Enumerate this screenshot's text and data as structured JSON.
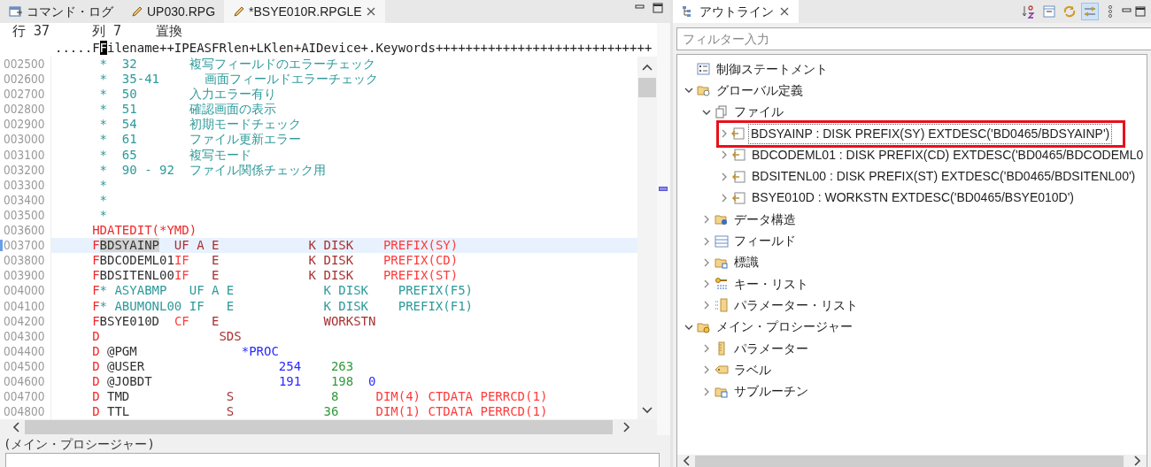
{
  "editor_tabs": [
    {
      "label": "コマンド・ログ",
      "kind": "log",
      "selected": false
    },
    {
      "label": "UP030.RPG",
      "kind": "source",
      "selected": false
    },
    {
      "label": "*BSYE010R.RPGLE",
      "kind": "source",
      "selected": true
    }
  ],
  "editor": {
    "position": {
      "line": "行 37",
      "column": "列 7",
      "mode": "置換"
    },
    "ruler": {
      "before": ".....F",
      "cursor": "F",
      "after": "ilename++IPEASFRlen+LKlen+AIDevice+.Keywords+++++++++++++++++++++++++++++"
    },
    "lines": [
      {
        "number": "002500",
        "current": false,
        "segments": [
          {
            "kind": "comment",
            "text": "      *  32       複写フィールドのエラーチェック"
          }
        ]
      },
      {
        "number": "002600",
        "current": false,
        "segments": [
          {
            "kind": "comment",
            "text": "      *  35-41      画面フィールドエラーチェック"
          }
        ]
      },
      {
        "number": "002700",
        "current": false,
        "segments": [
          {
            "kind": "comment",
            "text": "      *  50       入力エラー有り"
          }
        ]
      },
      {
        "number": "002800",
        "current": false,
        "segments": [
          {
            "kind": "comment",
            "text": "      *  51       確認画面の表示"
          }
        ]
      },
      {
        "number": "002900",
        "current": false,
        "segments": [
          {
            "kind": "comment",
            "text": "      *  54       初期モードチェック"
          }
        ]
      },
      {
        "number": "003000",
        "current": false,
        "segments": [
          {
            "kind": "comment",
            "text": "      *  61       ファイル更新エラー"
          }
        ]
      },
      {
        "number": "003100",
        "current": false,
        "segments": [
          {
            "kind": "comment",
            "text": "      *  65       複写モード"
          }
        ]
      },
      {
        "number": "003200",
        "current": false,
        "segments": [
          {
            "kind": "comment",
            "text": "      *  90 - 92  ファイル関係チェック用"
          }
        ]
      },
      {
        "number": "003300",
        "current": false,
        "segments": [
          {
            "kind": "comment",
            "text": "      *"
          }
        ]
      },
      {
        "number": "003400",
        "current": false,
        "segments": [
          {
            "kind": "comment",
            "text": "      *"
          }
        ]
      },
      {
        "number": "003500",
        "current": false,
        "segments": [
          {
            "kind": "comment",
            "text": "      *"
          }
        ]
      },
      {
        "number": "003600",
        "current": false,
        "segments": [
          {
            "kind": "spec",
            "text": "     HDATEDIT(*YMD)"
          }
        ]
      },
      {
        "number": "003700",
        "current": true,
        "segments": [
          {
            "kind": "spec",
            "text": "     F"
          },
          {
            "kind": "marked",
            "text": "BDSYAINP"
          },
          {
            "kind": "attr",
            "text": "  UF A E            K DISK    "
          },
          {
            "kind": "keyword",
            "text": "PREFIX(SY)"
          }
        ]
      },
      {
        "number": "003800",
        "current": false,
        "segments": [
          {
            "kind": "spec",
            "text": "     F"
          },
          {
            "kind": "name",
            "text": "BDCODEML01"
          },
          {
            "kind": "keyword",
            "text": "IF"
          },
          {
            "kind": "attr",
            "text": "   E            K DISK    "
          },
          {
            "kind": "keyword",
            "text": "PREFIX(CD)"
          }
        ]
      },
      {
        "number": "003900",
        "current": false,
        "segments": [
          {
            "kind": "spec",
            "text": "     F"
          },
          {
            "kind": "name",
            "text": "BDSITENL00"
          },
          {
            "kind": "keyword",
            "text": "IF"
          },
          {
            "kind": "attr",
            "text": "   E            K DISK    "
          },
          {
            "kind": "keyword",
            "text": "PREFIX(ST)"
          }
        ]
      },
      {
        "number": "004000",
        "current": false,
        "segments": [
          {
            "kind": "spec",
            "text": "     F"
          },
          {
            "kind": "comment",
            "text": "* ASYABMP   UF A E            K DISK    PREFIX(F5)"
          }
        ]
      },
      {
        "number": "004100",
        "current": false,
        "segments": [
          {
            "kind": "spec",
            "text": "     F"
          },
          {
            "kind": "comment",
            "text": "* ABUMONL00 IF   E            K DISK    PREFIX(F1)"
          }
        ]
      },
      {
        "number": "004200",
        "current": false,
        "segments": [
          {
            "kind": "spec",
            "text": "     F"
          },
          {
            "kind": "name",
            "text": "BSYE010D  "
          },
          {
            "kind": "keyword",
            "text": "CF"
          },
          {
            "kind": "attr",
            "text": "   E              WORKSTN"
          }
        ]
      },
      {
        "number": "004300",
        "current": false,
        "segments": [
          {
            "kind": "spec",
            "text": "     D"
          },
          {
            "kind": "attr",
            "text": "                SDS"
          }
        ]
      },
      {
        "number": "004400",
        "current": false,
        "segments": [
          {
            "kind": "spec",
            "text": "     D"
          },
          {
            "kind": "name",
            "text": " @PGM"
          },
          {
            "kind": "number",
            "text": "              *PROC"
          }
        ]
      },
      {
        "number": "004500",
        "current": false,
        "segments": [
          {
            "kind": "spec",
            "text": "     D"
          },
          {
            "kind": "name",
            "text": " @USER"
          },
          {
            "kind": "number",
            "text": "                  254"
          },
          {
            "kind": "position",
            "text": "    263"
          }
        ]
      },
      {
        "number": "004600",
        "current": false,
        "segments": [
          {
            "kind": "spec",
            "text": "     D"
          },
          {
            "kind": "name",
            "text": " @JOBDT"
          },
          {
            "kind": "number",
            "text": "                 191"
          },
          {
            "kind": "position",
            "text": "    198"
          },
          {
            "kind": "number",
            "text": "  0"
          }
        ]
      },
      {
        "number": "004700",
        "current": false,
        "segments": [
          {
            "kind": "spec",
            "text": "     D"
          },
          {
            "kind": "name",
            "text": " TMD"
          },
          {
            "kind": "attr",
            "text": "             S"
          },
          {
            "kind": "position",
            "text": "             8"
          },
          {
            "kind": "keyword",
            "text": "     DIM(4) CTDATA PERRCD(1)"
          }
        ]
      },
      {
        "number": "004800",
        "current": false,
        "segments": [
          {
            "kind": "spec",
            "text": "     D"
          },
          {
            "kind": "name",
            "text": " TTL"
          },
          {
            "kind": "attr",
            "text": "             S"
          },
          {
            "kind": "position",
            "text": "            36"
          },
          {
            "kind": "keyword",
            "text": "     DIM(1) CTDATA PERRCD(1)"
          }
        ]
      }
    ],
    "context": "(メイン・プロシージャー)"
  },
  "outline": {
    "title": "アウトライン",
    "toolbar": [
      {
        "kind": "sort",
        "pressed": false
      },
      {
        "kind": "collapse",
        "pressed": false
      },
      {
        "kind": "sync",
        "pressed": false
      },
      {
        "kind": "link",
        "pressed": true
      },
      {
        "kind": "menu",
        "pressed": false
      }
    ],
    "filter": {
      "placeholder": "フィルター入力"
    },
    "tree": [
      {
        "label": "制御ステートメント",
        "kind": "statements",
        "selected": false
      },
      {
        "label": "グローバル定義",
        "kind": "global",
        "expanded": true,
        "selected": false,
        "children": [
          {
            "label": "ファイル",
            "kind": "files",
            "expanded": true,
            "selected": false,
            "children": [
              {
                "label": "BDSYAINP : DISK PREFIX(SY) EXTDESC('BD0465/BDSYAINP')",
                "kind": "file",
                "expanded": false,
                "selected": true,
                "boxed": true
              },
              {
                "label": "BDCODEML01 : DISK PREFIX(CD) EXTDESC('BD0465/BDCODEML0",
                "kind": "file",
                "expanded": false,
                "selected": false,
                "boxed": false
              },
              {
                "label": "BDSITENL00 : DISK PREFIX(ST) EXTDESC('BD0465/BDSITENL00')",
                "kind": "file",
                "expanded": false,
                "selected": false,
                "boxed": false
              },
              {
                "label": "BSYE010D : WORKSTN EXTDESC('BD0465/BSYE010D')",
                "kind": "file",
                "expanded": false,
                "selected": false,
                "boxed": false
              }
            ]
          },
          {
            "label": "データ構造",
            "kind": "datastruct",
            "expanded": false,
            "selected": false
          },
          {
            "label": "フィールド",
            "kind": "fields",
            "expanded": false,
            "selected": false
          },
          {
            "label": "標識",
            "kind": "indicators",
            "expanded": false,
            "selected": false
          },
          {
            "label": "キー・リスト",
            "kind": "keylist",
            "expanded": false,
            "selected": false
          },
          {
            "label": "パラメーター・リスト",
            "kind": "paramlist",
            "expanded": false,
            "selected": false
          }
        ]
      },
      {
        "label": "メイン・プロシージャー",
        "kind": "procedure",
        "expanded": true,
        "selected": false,
        "children": [
          {
            "label": "パラメーター",
            "kind": "parameters",
            "expanded": false,
            "selected": false
          },
          {
            "label": "ラベル",
            "kind": "labels",
            "expanded": false,
            "selected": false
          },
          {
            "label": "サブルーチン",
            "kind": "subroutines",
            "expanded": false,
            "selected": false
          }
        ]
      }
    ]
  }
}
